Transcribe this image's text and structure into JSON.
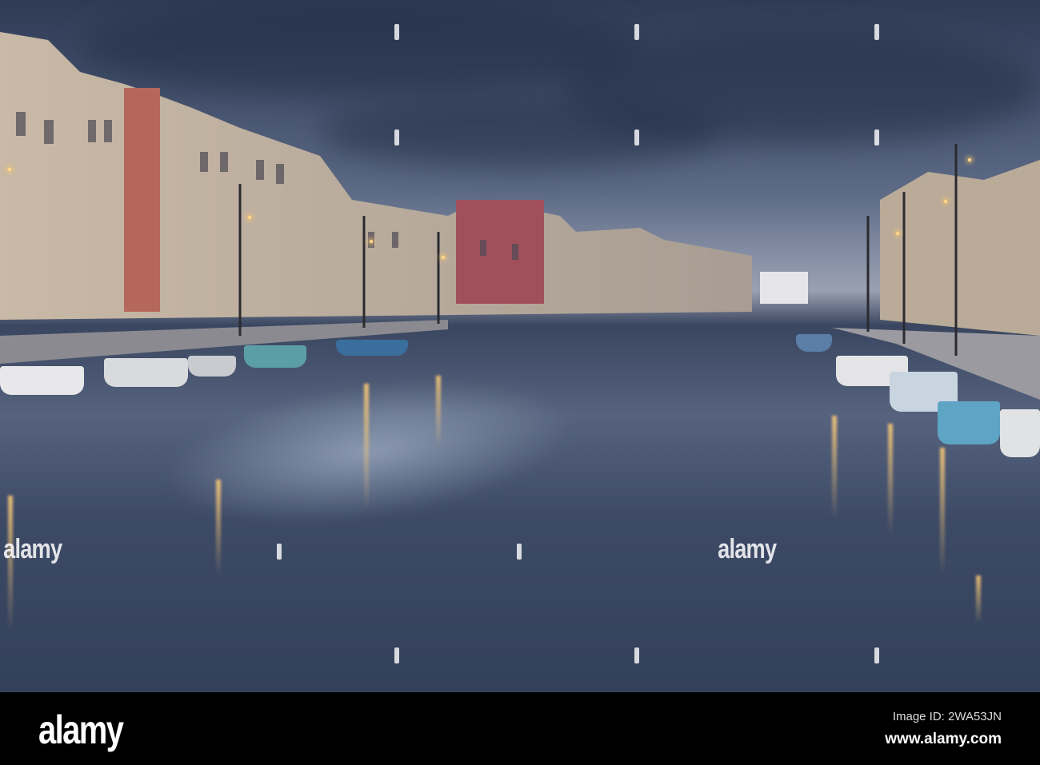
{
  "watermark": {
    "brand": "alamy"
  },
  "footer": {
    "logo": "alamy",
    "image_id": "Image ID: 2WA53JN",
    "url": "www.alamy.com"
  }
}
